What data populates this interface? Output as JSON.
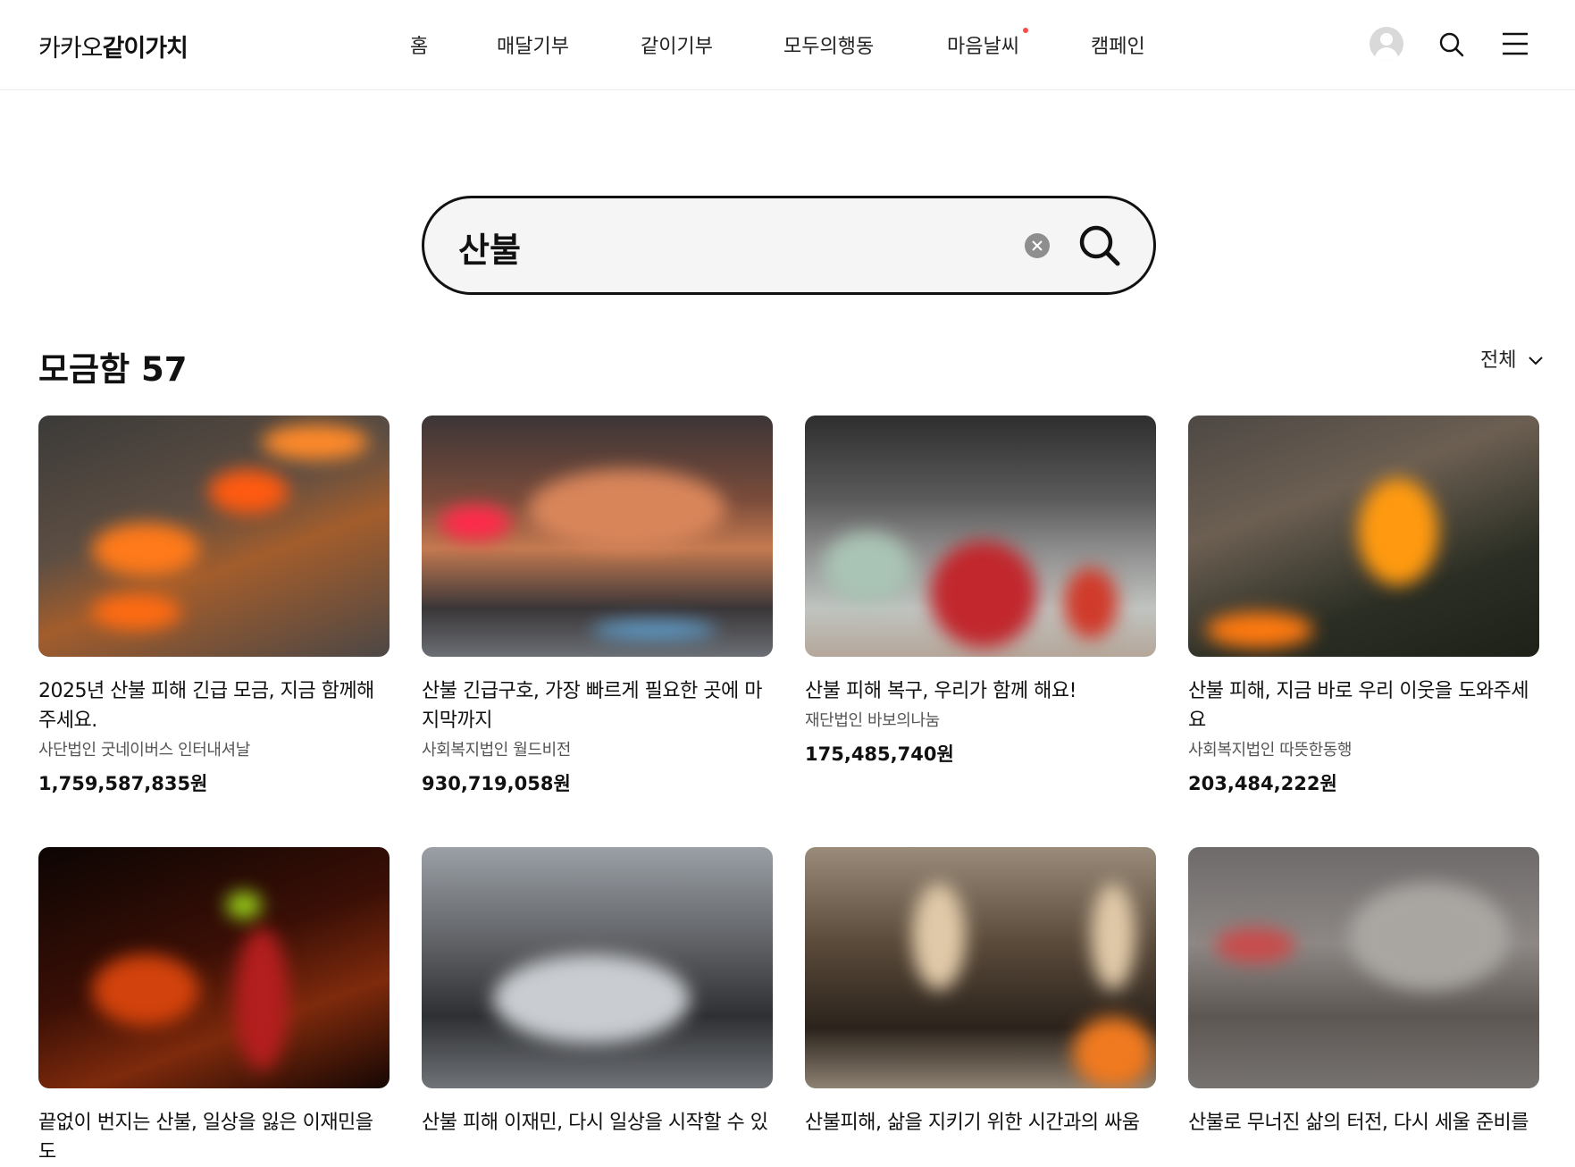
{
  "header": {
    "logo_prefix": "카카오",
    "logo_suffix": "같이가치",
    "nav": [
      {
        "label": "홈"
      },
      {
        "label": "매달기부"
      },
      {
        "label": "같이기부"
      },
      {
        "label": "모두의행동"
      },
      {
        "label": "마음날씨"
      },
      {
        "label": "캠페인"
      }
    ]
  },
  "search": {
    "value": "산불"
  },
  "section": {
    "title": "모금함 57",
    "filter_label": "전체"
  },
  "cards": [
    {
      "title": "2025년 산불 피해 긴급 모금, 지금 함께해 주세요.",
      "org": "사단법인 굿네이버스 인터내셔날",
      "amount": "1,759,587,835원"
    },
    {
      "title": "산불 긴급구호, 가장 빠르게 필요한 곳에 마지막까지",
      "org": "사회복지법인 월드비전",
      "amount": "930,719,058원"
    },
    {
      "title": "산불 피해 복구, 우리가 함께 해요!",
      "org": "재단법인 바보의나눔",
      "amount": "175,485,740원"
    },
    {
      "title": "산불 피해, 지금 바로 우리 이웃을 도와주세요",
      "org": "사회복지법인 따뜻한동행",
      "amount": "203,484,222원"
    },
    {
      "title": "끝없이 번지는 산불, 일상을 잃은 이재민을 도",
      "org": "",
      "amount": ""
    },
    {
      "title": "산불 피해 이재민, 다시 일상을 시작할 수 있",
      "org": "",
      "amount": ""
    },
    {
      "title": "산불피해, 삶을 지키기 위한 시간과의 싸움",
      "org": "",
      "amount": ""
    },
    {
      "title": "산불로 무너진 삶의 터전, 다시 세울 준비를",
      "org": "",
      "amount": ""
    }
  ]
}
